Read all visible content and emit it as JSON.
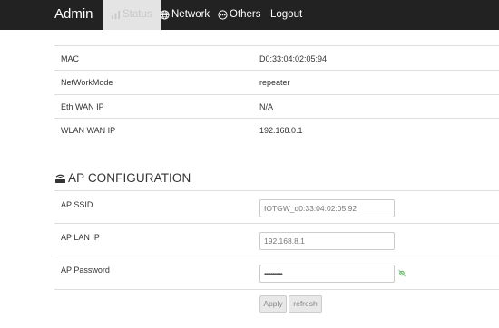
{
  "navbar": {
    "brand": "Admin",
    "items": [
      {
        "label": "Status",
        "icon": "status-icon",
        "active": true
      },
      {
        "label": "Network",
        "icon": "globe-icon",
        "active": false
      },
      {
        "label": "Others",
        "icon": "more-icon",
        "active": false
      },
      {
        "label": "Logout",
        "icon": "",
        "active": false
      }
    ]
  },
  "status": {
    "rows": [
      {
        "label": "MAC",
        "value": "D0:33:04:02:05:94"
      },
      {
        "label": "NetWorkMode",
        "value": "repeater"
      },
      {
        "label": "Eth WAN IP",
        "value": "N/A"
      },
      {
        "label": "WLAN WAN IP",
        "value": "192.168.0.1"
      }
    ]
  },
  "ap_config": {
    "title": "AP CONFIGURATION",
    "icon": "router-icon",
    "ssid_label": "AP SSID",
    "ssid_placeholder": "IOTGW_d0:33:04:02:05:92",
    "lan_ip_label": "AP LAN IP",
    "lan_ip_value": "192.168.8.1",
    "password_label": "AP Password",
    "password_value": "•••••••••••",
    "password_toggle_icon": "eye-icon",
    "apply_label": "Apply",
    "refresh_label": "refresh"
  },
  "colors": {
    "navbar_bg": "#222222",
    "active_tab_bg": "#e4e4e4",
    "toggle_icon": "#5cb85c"
  }
}
